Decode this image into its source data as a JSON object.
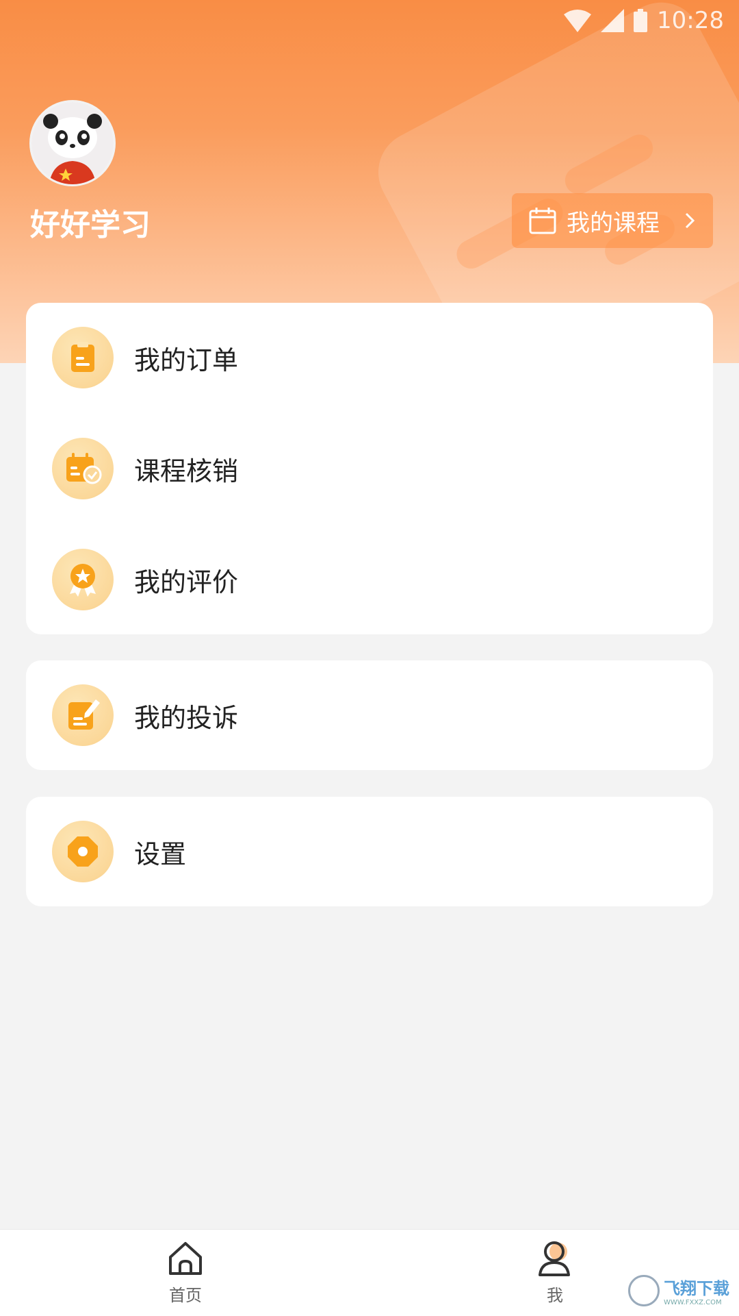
{
  "status_bar": {
    "time": "10:28"
  },
  "profile": {
    "username": "好好学习",
    "my_courses_label": "我的课程"
  },
  "menu_groups": [
    {
      "items": [
        {
          "label": "我的订单",
          "icon": "clipboard-icon"
        },
        {
          "label": "课程核销",
          "icon": "calendar-check-icon"
        },
        {
          "label": "我的评价",
          "icon": "award-icon"
        }
      ]
    },
    {
      "items": [
        {
          "label": "我的投诉",
          "icon": "edit-note-icon"
        }
      ]
    },
    {
      "items": [
        {
          "label": "设置",
          "icon": "gear-icon"
        }
      ]
    }
  ],
  "tabbar": {
    "home_label": "首页",
    "me_label": "我"
  },
  "watermark": {
    "text": "飞翔下载",
    "sub": "WWW.FXXZ.COM"
  },
  "colors": {
    "accent": "#f98d45",
    "icon_orange": "#f8a21b",
    "icon_bg": "#fbd89a"
  }
}
